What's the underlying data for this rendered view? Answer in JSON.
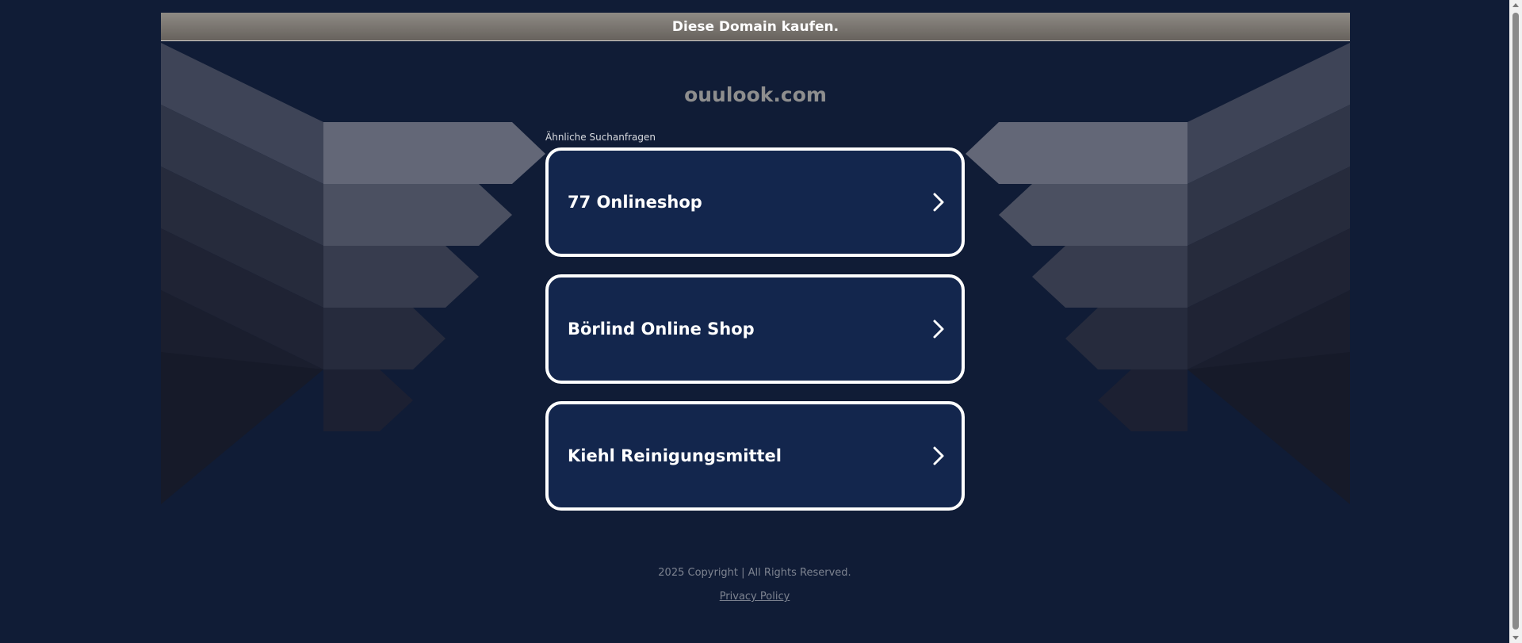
{
  "topbar": {
    "buy_label": "Diese Domain kaufen."
  },
  "domain": {
    "name": "ouulook.com"
  },
  "related": {
    "label": "Ähnliche Suchanfragen",
    "items": [
      {
        "label": "77 Onlineshop"
      },
      {
        "label": "Börlind Online Shop"
      },
      {
        "label": "Kiehl Reinigungsmittel"
      }
    ]
  },
  "footer": {
    "copyright": "2025 Copyright | All Rights Reserved.",
    "privacy": "Privacy Policy"
  },
  "colors": {
    "background": "#101c36",
    "card": "#13264d",
    "card_border": "#ffffff",
    "topbar_top": "#8e8a84",
    "topbar_bottom": "#67625d"
  },
  "icons": {
    "result_arrow": "chevron-right-icon"
  }
}
